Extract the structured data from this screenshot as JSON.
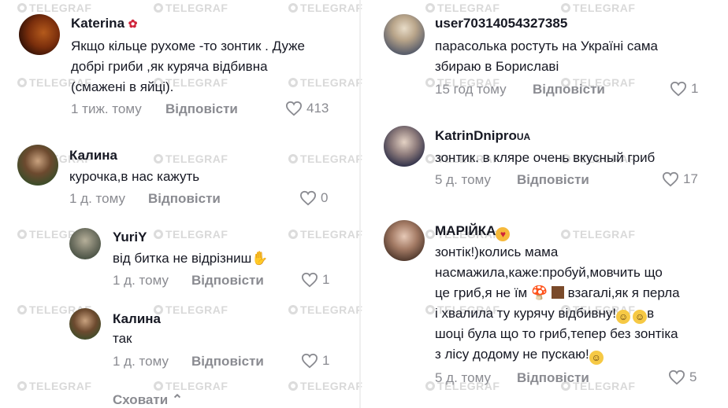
{
  "watermark": "TELEGRAF",
  "left": {
    "comments": [
      {
        "name": "Katerina",
        "name_emoji": "rose-emoji",
        "lines": [
          "Якщо кільце рухоме -то зонтик . Дуже",
          "добрі гриби ,як куряча відбивна",
          "(смажені в яйці)."
        ],
        "time": "1 тиж. тому",
        "reply": "Відповісти",
        "likes": "413"
      },
      {
        "name": "Калина",
        "lines": [
          "курочка,в нас кажуть"
        ],
        "time": "1 д. тому",
        "reply": "Відповісти",
        "likes": "0"
      },
      {
        "name": "YuriY",
        "lines": [
          "від битка не відрізниш"
        ],
        "time": "1 д. тому",
        "reply": "Відповісти",
        "likes": "1"
      },
      {
        "name": "Калина",
        "lines": [
          "так"
        ],
        "time": "1 д. тому",
        "reply": "Відповісти",
        "likes": "1"
      }
    ],
    "hide_label": "Сховати"
  },
  "right": {
    "comments": [
      {
        "name": "user70314054327385",
        "lines": [
          "парасолька ростуть на Україні сама",
          "збираю в Бориславі"
        ],
        "time": "15 год тому",
        "reply": "Відповісти",
        "likes": "1"
      },
      {
        "name": "KatrinDnipro",
        "name_suffix": "UA",
        "lines": [
          "зонтик. в кляре очень вкусный гриб"
        ],
        "time": "5 д. тому",
        "reply": "Відповісти",
        "likes": "17"
      },
      {
        "name": "МАРІЙКА",
        "lines": [
          "зонтік!)колись мама",
          "насмажила,каже:пробуй,мовчить що",
          "це гриб,я не їм",
          "взагалі,як я перла",
          "і хвалила ту курячу відбивну!",
          "в",
          "шоці була що то гриб,тепер без зонтіка",
          "з лісу додому не пускаю!"
        ],
        "time": "5 д. тому",
        "reply": "Відповісти",
        "likes": "5"
      }
    ]
  },
  "colors": {
    "text": "#161823",
    "meta": "#8a8b91",
    "watermark": "#d9d9d9"
  }
}
